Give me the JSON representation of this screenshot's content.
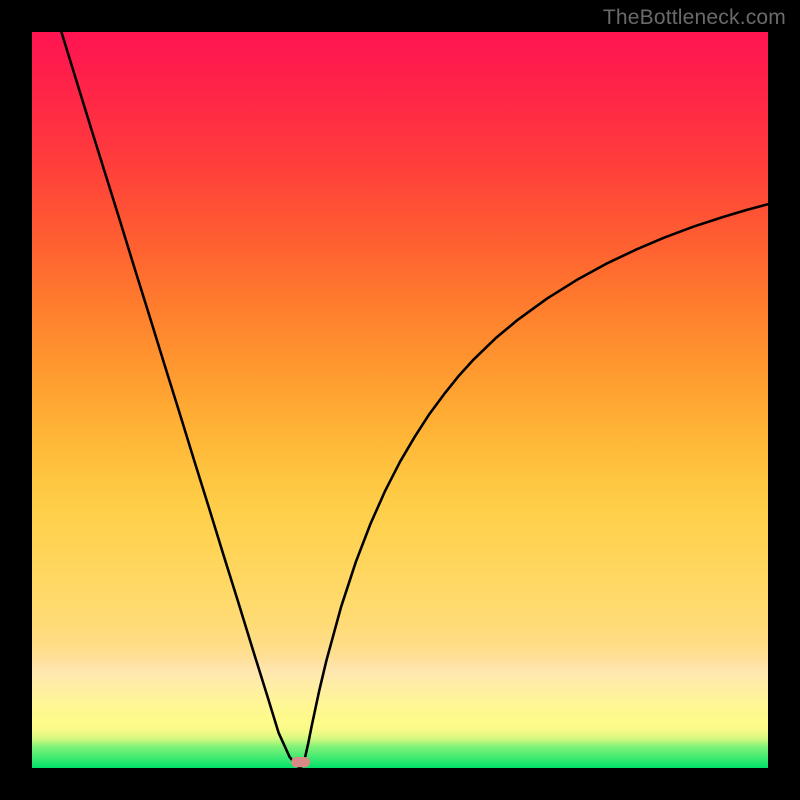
{
  "watermark": "TheBottleneck.com",
  "marker": {
    "color": "#d98a86",
    "x_pct": 36.5,
    "y_pct": 0.3
  },
  "chart_data": {
    "type": "line",
    "title": "",
    "xlabel": "",
    "ylabel": "",
    "xlim": [
      0,
      100
    ],
    "ylim": [
      0,
      100
    ],
    "grid": false,
    "legend": false,
    "annotations": [],
    "background": "rainbow-gradient (green bottom -> red top)",
    "series": [
      {
        "name": "left-branch",
        "x": [
          4,
          6,
          8,
          10,
          12,
          14,
          16,
          18,
          20,
          22,
          24,
          26,
          28,
          30,
          32,
          33.5,
          35,
          36,
          36.5
        ],
        "values": [
          100,
          93.5,
          87,
          80.6,
          74.2,
          67.7,
          61.3,
          54.8,
          48.4,
          41.9,
          35.5,
          29.0,
          22.6,
          16.1,
          9.7,
          4.8,
          1.5,
          0.3,
          0
        ]
      },
      {
        "name": "right-branch",
        "x": [
          36.5,
          37,
          37.5,
          38,
          39,
          40,
          42,
          44,
          46,
          48,
          50,
          52,
          54,
          56,
          58,
          60,
          63,
          66,
          70,
          74,
          78,
          82,
          86,
          90,
          94,
          97,
          100
        ],
        "values": [
          0,
          1.0,
          3.2,
          5.7,
          10.4,
          14.6,
          21.9,
          28.0,
          33.2,
          37.7,
          41.6,
          45.0,
          48.1,
          50.8,
          53.3,
          55.5,
          58.4,
          60.9,
          63.8,
          66.3,
          68.5,
          70.4,
          72.1,
          73.6,
          74.9,
          75.8,
          76.6
        ]
      }
    ],
    "markers": [
      {
        "name": "vertex-marker",
        "x": 36.5,
        "y": 0.3,
        "shape": "rounded-rect",
        "color": "#d98a86"
      }
    ]
  }
}
